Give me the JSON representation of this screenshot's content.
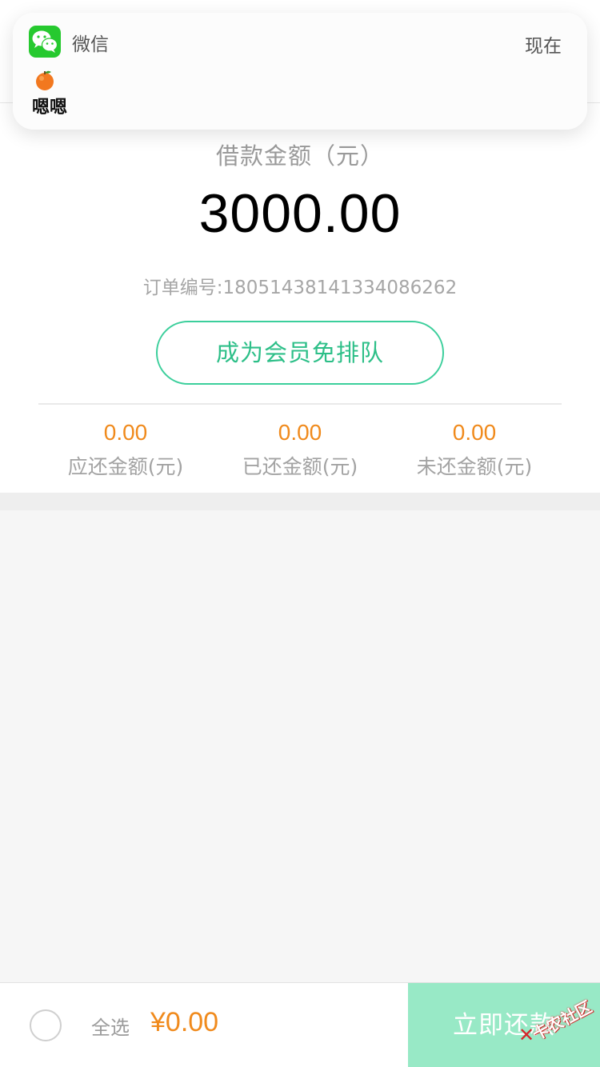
{
  "notification": {
    "app_name": "微信",
    "time": "现在",
    "message": "嗯嗯",
    "icon": "wechat-icon",
    "emoji_icon": "orange-icon"
  },
  "summary": {
    "loan_label": "借款金额（元）",
    "loan_amount": "3000.00",
    "order_number": "订单编号:18051438141334086262",
    "vip_button": "成为会员免排队",
    "stats": [
      {
        "value": "0.00",
        "label": "应还金额(元)"
      },
      {
        "value": "0.00",
        "label": "已还金额(元)"
      },
      {
        "value": "0.00",
        "label": "未还金额(元)"
      }
    ]
  },
  "bottom_bar": {
    "select_all_label": "全选",
    "total_amount": "¥0.00",
    "repay_button": "立即还款"
  },
  "watermark": {
    "text": "卡农社区",
    "mark": "✕"
  },
  "colors": {
    "accent_green": "#3ccf9c",
    "amount_orange": "#f08a1c",
    "repay_button_bg": "#98e9c6",
    "wechat_green": "#26c92f"
  }
}
